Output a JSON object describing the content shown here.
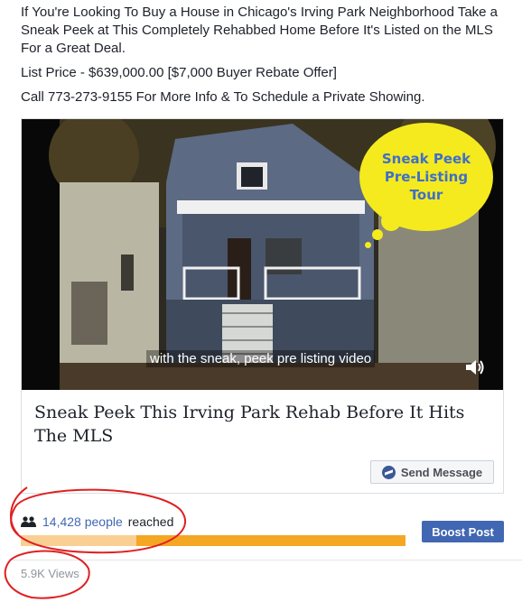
{
  "post": {
    "paragraph1": "If You're Looking To Buy a House in Chicago's Irving Park Neighborhood Take a Sneak Peek at This Completely Rehabbed Home Before It's Listed on the MLS For a Great Deal.",
    "paragraph2": "List Price - $639,000.00 [$7,000 Buyer Rebate Offer]",
    "paragraph3": "Call 773-273-9155 For More Info & To Schedule a Private Showing."
  },
  "video": {
    "bubble_text": "Sneak Peek\nPre-Listing\nTour",
    "caption": "with the sneak, peek pre listing video",
    "bubble_color": "#f5ea1e",
    "bubble_text_color": "#3f6fc8"
  },
  "link": {
    "title": "Sneak Peek This Irving Park Rehab Before It Hits The MLS",
    "send_button": "Send Message"
  },
  "insights": {
    "reach_count": "14,428 people",
    "reach_suffix": "reached",
    "reach_progress": 0.3,
    "boost_button": "Boost Post",
    "views": "5.9K Views"
  },
  "colors": {
    "link_blue": "#4267b2",
    "progress_fill": "#f9cf93",
    "progress_track": "#f5a623",
    "annotation_red": "#e02020"
  }
}
